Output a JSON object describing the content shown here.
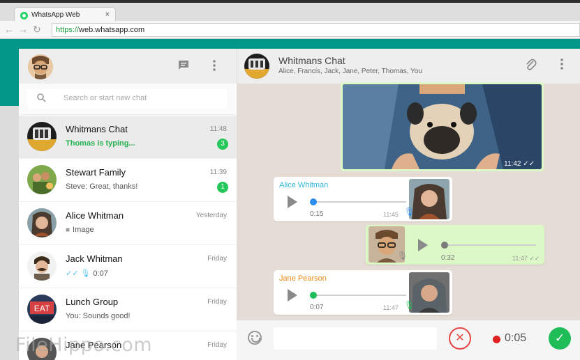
{
  "browser": {
    "tab_title": "WhatsApp Web",
    "tab_close": "×",
    "url_scheme": "https://",
    "url_rest": "web.whatsapp.com",
    "back_icon": "←",
    "forward_icon": "→",
    "reload_icon": "↻"
  },
  "sidebar": {
    "search_placeholder": "Search or start new chat",
    "chats": [
      {
        "name": "Whitmans Chat",
        "time": "11:48",
        "preview": "Thomas is typing...",
        "unread": "3"
      },
      {
        "name": "Stewart Family",
        "time": "11:39",
        "preview": "Steve: Great, thanks!",
        "unread": "1"
      },
      {
        "name": "Alice Whitman",
        "time": "Yesterday",
        "preview": "Image"
      },
      {
        "name": "Jack Whitman",
        "time": "Friday",
        "preview": "0:07"
      },
      {
        "name": "Lunch Group",
        "time": "Friday",
        "preview": "You: Sounds good!"
      },
      {
        "name": "Jane Pearson",
        "time": "Friday",
        "preview": ""
      }
    ]
  },
  "conversation": {
    "title": "Whitmans Chat",
    "members": "Alice, Francis, Jack, Jane, Peter, Thomas, You",
    "image_message_time": "11:42",
    "messages": [
      {
        "sender": "Alice Whitman",
        "duration": "0:15",
        "time": "11:45",
        "progress": 0.04
      },
      {
        "sender": "",
        "duration": "0:32",
        "time": "11:47",
        "progress": 0.0
      },
      {
        "sender": "Jane Pearson",
        "duration": "0:07",
        "time": "11:47",
        "progress": 0.04
      }
    ]
  },
  "composer": {
    "recording_time": "0:05",
    "cancel_icon": "✕",
    "send_icon": "✓"
  },
  "watermark": "FileHippo.com",
  "colors": {
    "brand_teal": "#009688",
    "typing_green": "#25b252",
    "sender_alice": "#2eb8d6",
    "sender_jane": "#f08a15",
    "outgoing_bubble": "#dcf8c6",
    "record_red": "#e02020"
  }
}
